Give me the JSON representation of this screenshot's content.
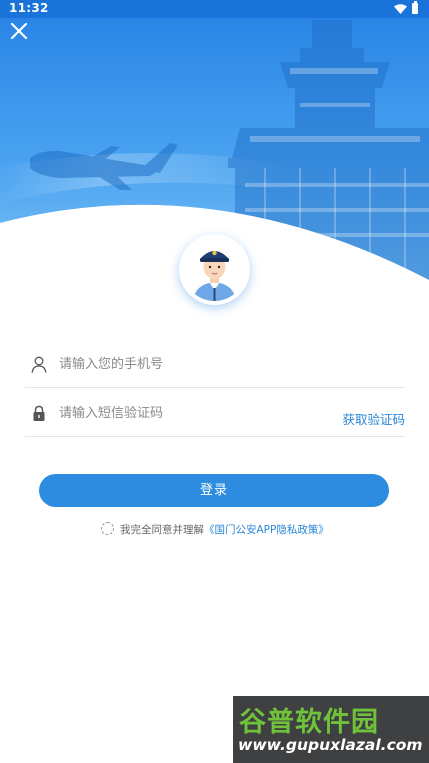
{
  "status_bar": {
    "time": "11:32"
  },
  "form": {
    "phone_placeholder": "请输入您的手机号",
    "code_placeholder": "请输入短信验证码",
    "get_code_label": "获取验证码",
    "login_label": "登录"
  },
  "agreement": {
    "text": "我完全同意并理解",
    "policy_link": "《国门公安APP隐私政策》"
  },
  "watermark": {
    "brand": "谷普软件园",
    "url": "www.gupuxlazal.com"
  },
  "icons": [
    "wifi-icon",
    "battery-icon",
    "close-icon",
    "user-icon",
    "lock-icon",
    "radio-icon"
  ],
  "colors": {
    "primary": "#2d8ce0",
    "status_bar": "#1a73d8",
    "link": "#2a86d8",
    "watermark_green": "#6fc23a"
  }
}
